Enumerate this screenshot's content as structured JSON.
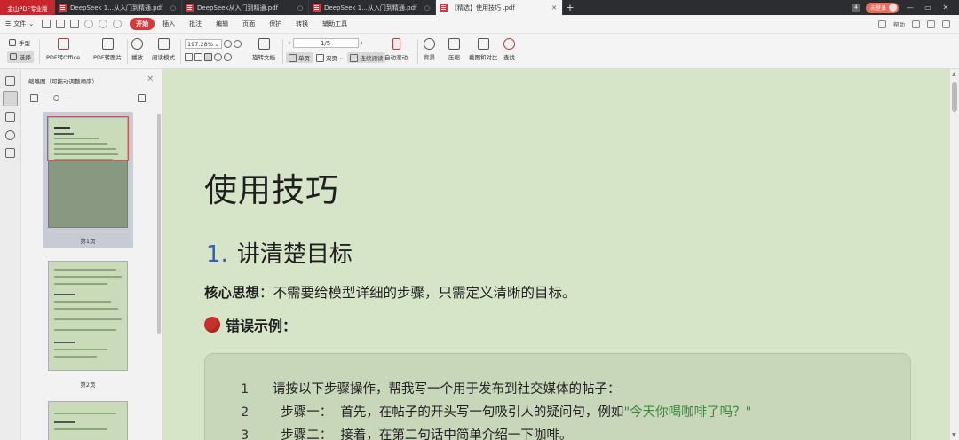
{
  "titlebar": {
    "app_name": "金山PDF专业版",
    "tabs": [
      {
        "label": "DeepSeek 1...从入门到精通.pdf",
        "active": false
      },
      {
        "label": "DeepSeek从入门到精通.pdf",
        "active": false
      },
      {
        "label": "DeepSeek 1...从入门到精通.pdf",
        "active": false
      },
      {
        "label": "【精选】使用技巧 .pdf",
        "active": true
      }
    ],
    "add_tab": "+",
    "page_badge": "4",
    "user_label": "未登录",
    "window_controls": [
      "—",
      "▭",
      "✕"
    ]
  },
  "menubar": {
    "file_label": "文件",
    "tabs": [
      "开始",
      "插入",
      "批注",
      "编辑",
      "页面",
      "保护",
      "转换",
      "辅助工具"
    ],
    "active_tab": "开始",
    "right_label": "帮助"
  },
  "toolbar": {
    "hand": "手型",
    "select": "选择",
    "pdf_to_office": "PDF转Office",
    "pdf_to_image": "PDF转图片",
    "play": "播放",
    "read_mode": "阅读模式",
    "zoom": "197.28%",
    "rotate": "旋转文档",
    "page_display": "1/5",
    "single_page": "单页",
    "double_page": "双页",
    "continuous": "连续阅读",
    "auto_scroll": "自动滚动",
    "background": "背景",
    "compress": "压缩",
    "screenshot_compare": "截图和对比",
    "find": "查找"
  },
  "thumbnails": {
    "title": "缩略图（可拖动调整顺序）",
    "close": "×",
    "slider_level": 0.55,
    "pages": [
      {
        "label": "第1页",
        "selected": true
      },
      {
        "label": "第2页",
        "selected": false
      }
    ]
  },
  "document": {
    "title": "使用技巧",
    "section_number": "1.",
    "section_title": "讲清楚目标",
    "core_label": "核心思想",
    "core_text": "：不需要给模型详细的步骤，只需定义清晰的目标。",
    "wrong_label": "错误示例：",
    "code_lines": [
      {
        "ln": "1",
        "text": "请按以下步骤操作，帮我写一个用于发布到社交媒体的帖子：",
        "quote": ""
      },
      {
        "ln": "2",
        "text": "  步骤一：  首先，在帖子的开头写一句吸引人的疑问句，例如",
        "quote": "\"今天你喝咖啡了吗？\""
      },
      {
        "ln": "3",
        "text": "  步骤二：  接着，在第二句话中简单介绍一下咖啡。",
        "quote": ""
      }
    ]
  },
  "colors": {
    "accent": "#d33a3a",
    "page_bg": "#d6e4c8",
    "code_bg": "#c8d6ba",
    "section_num": "#2f5ec4",
    "string": "#3b8a3b"
  }
}
